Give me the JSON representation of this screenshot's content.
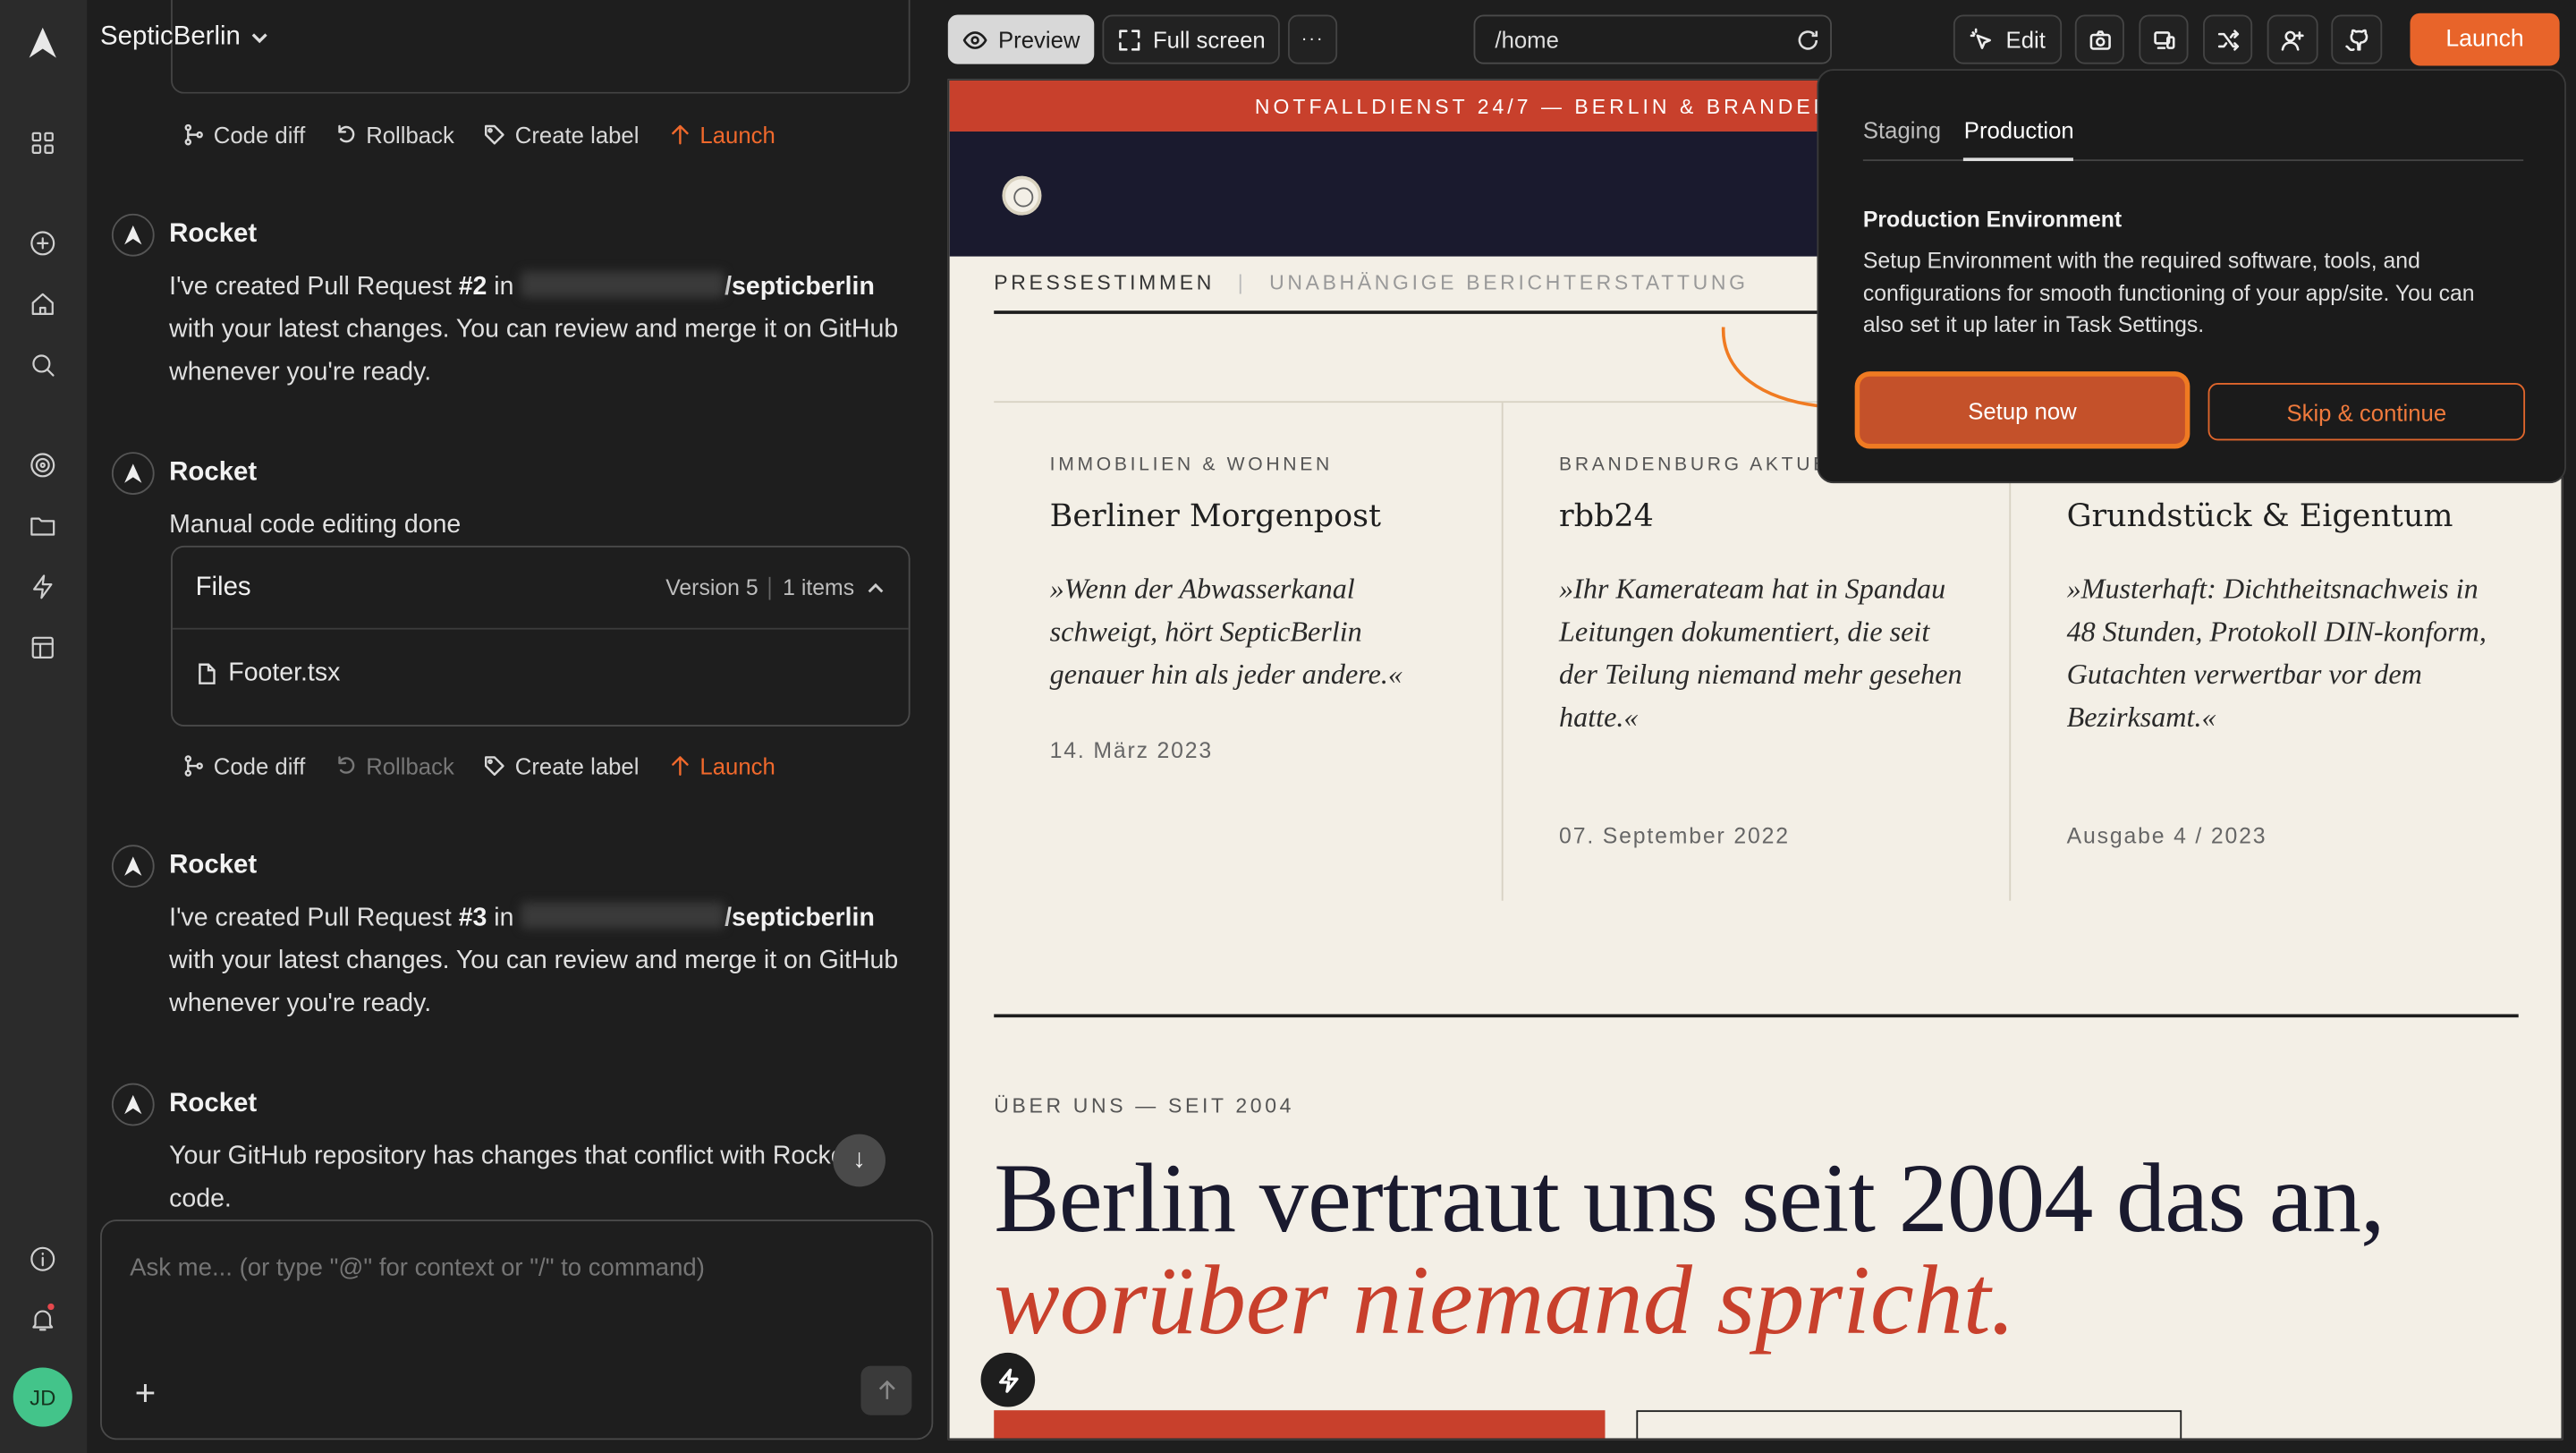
{
  "project": {
    "name": "SepticBerlin"
  },
  "actions_row_1": {
    "code_diff": "Code diff",
    "rollback": "Rollback",
    "create_label": "Create label",
    "launch": "Launch"
  },
  "actions_row_2": {
    "code_diff": "Code diff",
    "rollback": "Rollback",
    "create_label": "Create label",
    "launch": "Launch"
  },
  "messages": [
    {
      "author": "Rocket",
      "pre": "I've created Pull Request ",
      "pr": "#2",
      "mid": " in ",
      "repo": "/septicberlin",
      "post": " with your latest changes. You can review and merge it on GitHub whenever you're ready."
    },
    {
      "author": "Rocket",
      "text": "Manual code editing done"
    },
    {
      "author": "Rocket",
      "pre": "I've created Pull Request ",
      "pr": "#3",
      "mid": " in ",
      "repo": "/septicberlin",
      "post": " with your latest changes. You can review and merge it on GitHub whenever you're ready."
    },
    {
      "author": "Rocket",
      "text": "Your GitHub repository has changes that conflict with Rocket's code."
    }
  ],
  "files_card": {
    "title": "Files",
    "version": "Version 5",
    "items": "1 items",
    "file": "Footer.tsx"
  },
  "composer": {
    "placeholder": "Ask me... (or type \"@\" for context or \"/\" to command)"
  },
  "toolbar": {
    "preview": "Preview",
    "full_screen": "Full screen",
    "more": "···",
    "url": "/home",
    "edit": "Edit",
    "launch": "Launch"
  },
  "avatar": {
    "initials": "JD"
  },
  "site": {
    "topbar": "NOTFALLDIENST 24/7 — BERLIN & BRANDEN",
    "press_label": "PRESSESTIMMEN",
    "press_sep": "|",
    "press_sub": "UNABHÄNGIGE BERICHTERSTATTUNG",
    "cards": [
      {
        "kicker": "IMMOBILIEN & WOHNEN",
        "title": "Berliner Morgenpost",
        "quote": "»Wenn der Abwasserkanal schweigt, hört SepticBerlin genauer hin als jeder andere.«",
        "date": "14. März 2023"
      },
      {
        "kicker": "BRANDENBURG AKTUELL",
        "title": "rbb24",
        "quote": "»Ihr Kamerateam hat in Spandau Leitungen dokumentiert, die seit der Teilung niemand mehr gesehen hatte.«",
        "date": "07. September 2022"
      },
      {
        "kicker": "",
        "title": "Grundstück & Eigentum",
        "quote": "»Musterhaft: Dichtheitsnachweis in 48 Stunden, Protokoll DIN-konform, Gutachten verwertbar vor dem Bezirksamt.«",
        "date": "Ausgabe 4 / 2023"
      }
    ],
    "about_kicker": "ÜBER UNS — SEIT 2004",
    "hero_line1": "Berlin vertraut uns seit 2004 das an,",
    "hero_line2": "worüber niemand spricht."
  },
  "popover": {
    "tabs": [
      "Staging",
      "Production"
    ],
    "active_tab": "Production",
    "title": "Production Environment",
    "description": "Setup Environment with the required software, tools, and configurations for smooth functioning of your app/site. You can also set it up later in Task Settings.",
    "primary": "Setup now",
    "secondary": "Skip & continue"
  },
  "colors": {
    "accent": "#e8642a",
    "site_red": "#c8402c",
    "site_navy": "#1a1a2e",
    "avatar": "#43c48a"
  }
}
